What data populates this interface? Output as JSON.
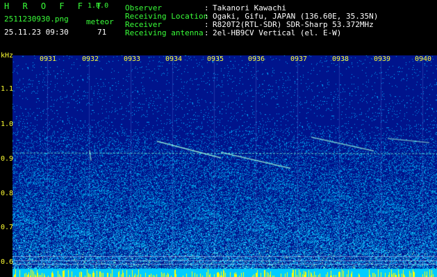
{
  "header": {
    "app_title": "H R O F F T",
    "version": "1.0.0",
    "filename": "2511230930.png",
    "datetime": "25.11.23 09:30",
    "meteor_label": "meteor",
    "meteor_count": "71",
    "info_labels": [
      "Observer",
      "Receiving Location",
      "Receiver",
      "Receiving antenna"
    ],
    "info_colons": [
      ":",
      ":",
      ":",
      ":"
    ],
    "info_values": [
      "Takanori Kawachi",
      "Ogaki, Gifu, JAPAN (136.60E, 35.35N)",
      "R820T2(RTL-SDR) SDR-Sharp 53.372MHz",
      "2el-HB9CV Vertical (el. E-W)"
    ]
  },
  "axis": {
    "unit": "kHz",
    "y_ticks": [
      "1.1",
      "1.0",
      "0.9",
      "0.8",
      "0.7",
      "0.6"
    ],
    "x_ticks": [
      "0931",
      "0932",
      "0933",
      "0934",
      "0935",
      "0936",
      "0937",
      "0938",
      "0939",
      "0940"
    ]
  },
  "colors": {
    "label_green": "#39ff39",
    "axis_yellow": "#ffff33",
    "background_blue": "#001a8c",
    "noise_floor_cyan": "#00ccff"
  }
}
